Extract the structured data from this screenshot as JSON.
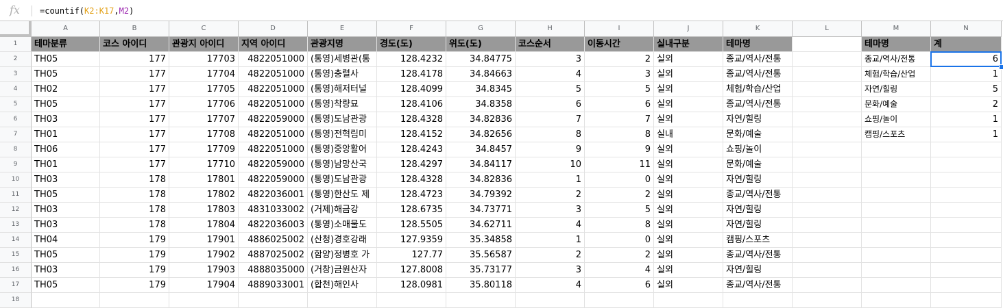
{
  "formula_bar": {
    "fx_label": "fx",
    "formula_prefix": "=countif(",
    "formula_ref1": "K2:K17",
    "formula_sep": ",",
    "formula_ref2": "M2",
    "formula_suffix": ")"
  },
  "columns": [
    "A",
    "B",
    "C",
    "D",
    "E",
    "F",
    "G",
    "H",
    "I",
    "J",
    "K",
    "L",
    "M",
    "N"
  ],
  "row_numbers": [
    "1",
    "2",
    "3",
    "4",
    "5",
    "6",
    "7",
    "8",
    "9",
    "10",
    "11",
    "12",
    "13",
    "14",
    "15",
    "16",
    "17",
    "18"
  ],
  "headers": [
    "테마분류",
    "코스 아이디",
    "관광지 아이디",
    "지역 아이디",
    "관광지명",
    "경도(도)",
    "위도(도)",
    "코스순서",
    "이동시간",
    "실내구분",
    "테마명"
  ],
  "rows": [
    [
      "TH05",
      "177",
      "17703",
      "4822051000",
      "(통영)세병관(통",
      "128.4232",
      "34.84775",
      "3",
      "2",
      "실외",
      "종교/역사/전통"
    ],
    [
      "TH05",
      "177",
      "17704",
      "4822051000",
      "(통영)충렬사",
      "128.4178",
      "34.84663",
      "4",
      "3",
      "실외",
      "종교/역사/전통"
    ],
    [
      "TH02",
      "177",
      "17705",
      "4822051000",
      "(통영)해저터널",
      "128.4099",
      "34.8345",
      "5",
      "5",
      "실외",
      "체험/학습/산업"
    ],
    [
      "TH05",
      "177",
      "17706",
      "4822051000",
      "(통영)착량묘",
      "128.4106",
      "34.8358",
      "6",
      "6",
      "실외",
      "종교/역사/전통"
    ],
    [
      "TH03",
      "177",
      "17707",
      "4822059000",
      "(통영)도남관광",
      "128.4328",
      "34.82836",
      "7",
      "7",
      "실외",
      "자연/힐링"
    ],
    [
      "TH01",
      "177",
      "17708",
      "4822051000",
      "(통영)전혁림미",
      "128.4152",
      "34.82656",
      "8",
      "8",
      "실내",
      "문화/예술"
    ],
    [
      "TH06",
      "177",
      "17709",
      "4822051000",
      "(통영)중앙활어",
      "128.4243",
      "34.8457",
      "9",
      "9",
      "실외",
      "쇼핑/놀이"
    ],
    [
      "TH01",
      "177",
      "17710",
      "4822059000",
      "(통영)남망산국",
      "128.4297",
      "34.84117",
      "10",
      "11",
      "실외",
      "문화/예술"
    ],
    [
      "TH03",
      "178",
      "17801",
      "4822059000",
      "(통영)도남관광",
      "128.4328",
      "34.82836",
      "1",
      "0",
      "실외",
      "자연/힐링"
    ],
    [
      "TH05",
      "178",
      "17802",
      "4822036001",
      "(통영)한산도 제",
      "128.4723",
      "34.79392",
      "2",
      "2",
      "실외",
      "종교/역사/전통"
    ],
    [
      "TH03",
      "178",
      "17803",
      "4831033002",
      "(거제)해금강",
      "128.6735",
      "34.73771",
      "3",
      "5",
      "실외",
      "자연/힐링"
    ],
    [
      "TH03",
      "178",
      "17804",
      "4822036003",
      "(통영)소매물도",
      "128.5505",
      "34.62711",
      "4",
      "8",
      "실외",
      "자연/힐링"
    ],
    [
      "TH04",
      "179",
      "17901",
      "4886025002",
      "(산청)경호강래",
      "127.9359",
      "35.34858",
      "1",
      "0",
      "실외",
      "캠핑/스포츠"
    ],
    [
      "TH05",
      "179",
      "17902",
      "4887025002",
      "(함양)정병호 가",
      "127.77",
      "35.56587",
      "2",
      "2",
      "실외",
      "종교/역사/전통"
    ],
    [
      "TH03",
      "179",
      "17903",
      "4888035000",
      "(거창)금원산자",
      "127.8008",
      "35.73177",
      "3",
      "4",
      "실외",
      "자연/힐링"
    ],
    [
      "TH05",
      "179",
      "17904",
      "4889033001",
      "(합천)해인사",
      "128.0981",
      "35.80118",
      "4",
      "6",
      "실외",
      "종교/역사/전통"
    ]
  ],
  "summary": {
    "header_theme": "테마명",
    "header_count": "계",
    "items": [
      {
        "theme": "종교/역사/전통",
        "count": "6"
      },
      {
        "theme": "체험/학습/산업",
        "count": "1"
      },
      {
        "theme": "자연/힐링",
        "count": "5"
      },
      {
        "theme": "문화/예술",
        "count": "2"
      },
      {
        "theme": "쇼핑/놀이",
        "count": "1"
      },
      {
        "theme": "캠핑/스포츠",
        "count": "1"
      }
    ]
  },
  "colors": {
    "header_fill": "#999999",
    "selection": "#1a73e8",
    "ref1": "#e3a21a",
    "ref2": "#9c27b0"
  }
}
